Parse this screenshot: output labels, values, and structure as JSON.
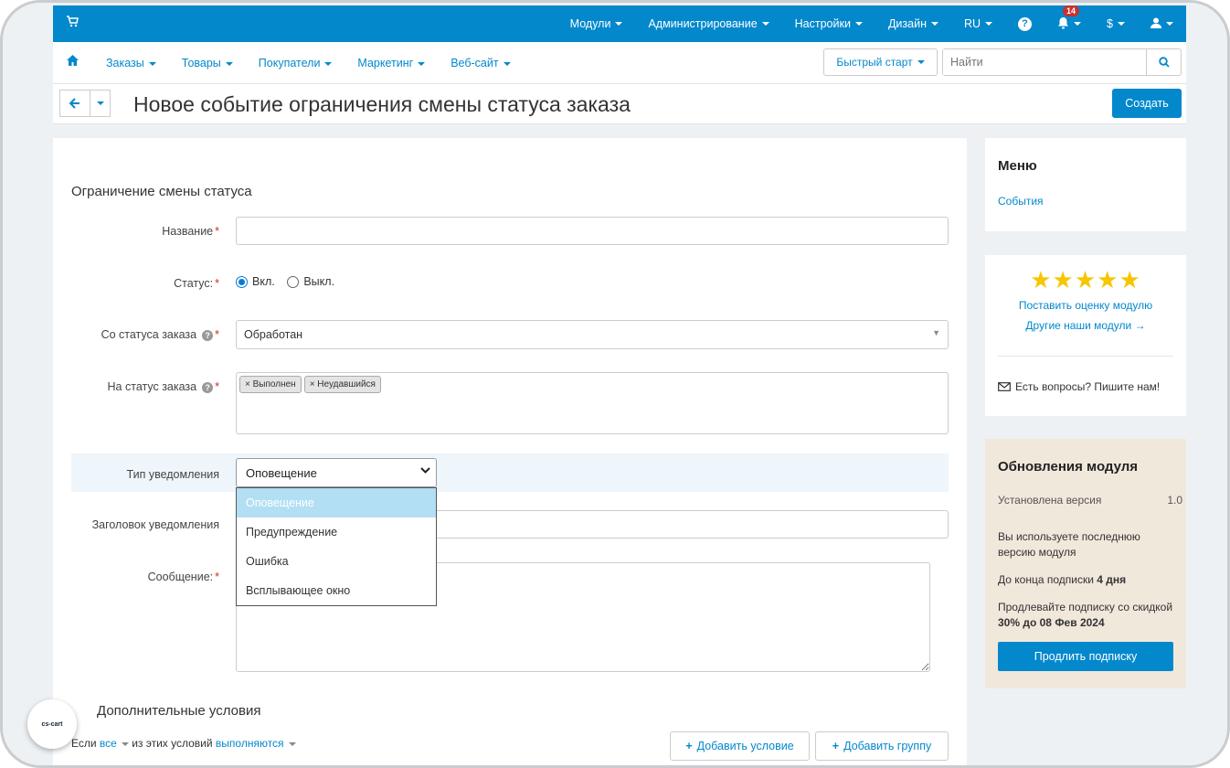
{
  "topbar": {
    "cart_icon": "cart-icon",
    "menu": [
      {
        "label": "Модули"
      },
      {
        "label": "Администрирование"
      },
      {
        "label": "Настройки"
      },
      {
        "label": "Дизайн"
      },
      {
        "label": "RU"
      }
    ],
    "notifications_count": "14",
    "currency": "$"
  },
  "subnav": {
    "links": [
      "Заказы",
      "Товары",
      "Покупатели",
      "Маркетинг",
      "Веб-сайт"
    ],
    "quick_start": "Быстрый старт",
    "search_placeholder": "Найти"
  },
  "header": {
    "title": "Новое событие ограничения смены статуса заказа",
    "create_label": "Создать"
  },
  "form": {
    "section_title": "Ограничение смены статуса",
    "name_label": "Название",
    "name_value": "",
    "status_label": "Статус:",
    "status_on": "Вкл.",
    "status_off": "Выкл.",
    "from_status_label": "Со статуса заказа",
    "from_status_value": "Обработан",
    "to_status_label": "На статус заказа",
    "to_status_tags": [
      "× Выполнен",
      "× Неудавшийся"
    ],
    "notify_type_label": "Тип уведомления",
    "notify_type_value": "Оповещение",
    "notify_options": [
      "Оповещение",
      "Предупреждение",
      "Ошибка",
      "Всплывающее окно"
    ],
    "notify_header_label": "Заголовок уведомления",
    "message_label": "Сообщение:",
    "extra_title": "Дополнительные условия",
    "cond_prefix": "Если",
    "cond_all": "все",
    "cond_mid": "из этих условий",
    "cond_met": "выполняются",
    "add_condition": "Добавить условие",
    "add_group": "Добавить группу"
  },
  "sidebar": {
    "menu_title": "Меню",
    "menu_link": "События",
    "stars": "★★★★★",
    "rate_link": "Поставить оценку модулю",
    "other_link": "Другие наши модули →",
    "questions": "Есть вопросы? Пишите нам!",
    "updates_title": "Обновления модуля",
    "installed_label": "Установлена версия",
    "installed_value": "1.0",
    "latest_text": "Вы используете последнюю версию модуля",
    "sub_prefix": "До конца подписки",
    "sub_value": "4 дня",
    "promo_prefix": "Продлевайте подписку со скидкой",
    "promo_value": "30% до 08 Фев 2024",
    "renew_label": "Продлить подписку"
  },
  "logo_text": "cs-cart"
}
